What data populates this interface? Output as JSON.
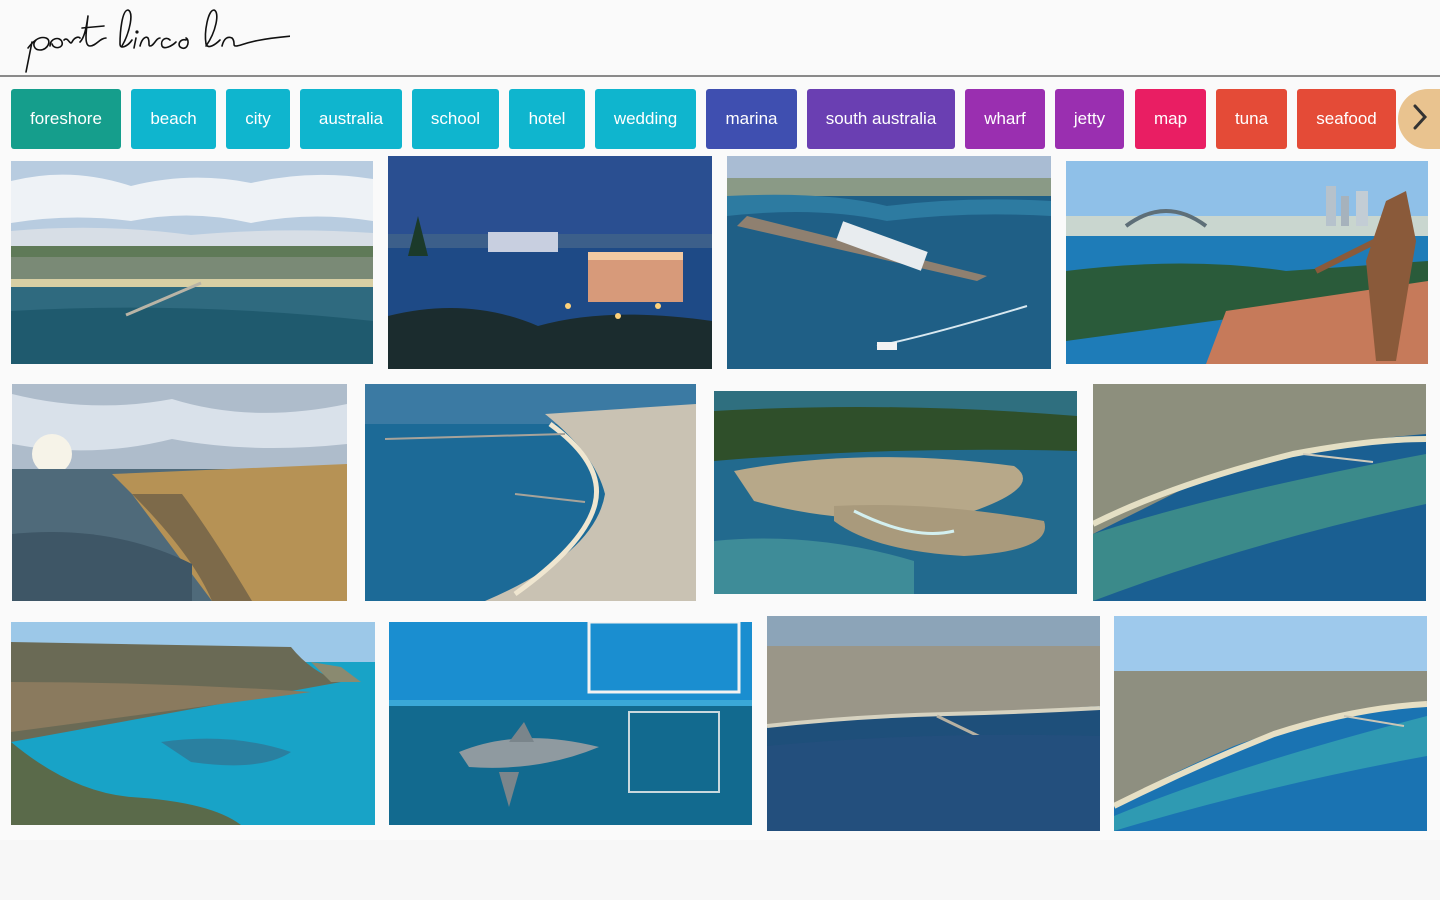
{
  "header": {
    "logo_text": "port lincoln"
  },
  "chips": [
    {
      "label": "foreshore",
      "color": "#159e8c"
    },
    {
      "label": "beach",
      "color": "#0fb5ce"
    },
    {
      "label": "city",
      "color": "#0fb5ce"
    },
    {
      "label": "australia",
      "color": "#0fb5ce"
    },
    {
      "label": "school",
      "color": "#0fb5ce"
    },
    {
      "label": "hotel",
      "color": "#0fb5ce"
    },
    {
      "label": "wedding",
      "color": "#0fb5ce"
    },
    {
      "label": "marina",
      "color": "#3f4fb0"
    },
    {
      "label": "south australia",
      "color": "#6a3fb2"
    },
    {
      "label": "wharf",
      "color": "#9a2fb0"
    },
    {
      "label": "jetty",
      "color": "#9a2fb0"
    },
    {
      "label": "map",
      "color": "#e91e63"
    },
    {
      "label": "tuna",
      "color": "#e44b37"
    },
    {
      "label": "seafood",
      "color": "#e44b37"
    }
  ],
  "next_icon": "chevron-right-icon",
  "photos": [
    {
      "subject": "foreshore-jetty-aerial"
    },
    {
      "subject": "town-at-dusk-hotel"
    },
    {
      "subject": "cruise-ship-at-wharf"
    },
    {
      "subject": "sydney-harbour-statue"
    },
    {
      "subject": "coastal-cliffs-sunset"
    },
    {
      "subject": "bay-and-town-aerial"
    },
    {
      "subject": "marina-aerial"
    },
    {
      "subject": "foreshore-beach-aerial"
    },
    {
      "subject": "turquoise-bay-cliffs"
    },
    {
      "subject": "shark-cage-diving"
    },
    {
      "subject": "town-and-jetty-aerial"
    },
    {
      "subject": "beach-jetty-aerial"
    }
  ]
}
